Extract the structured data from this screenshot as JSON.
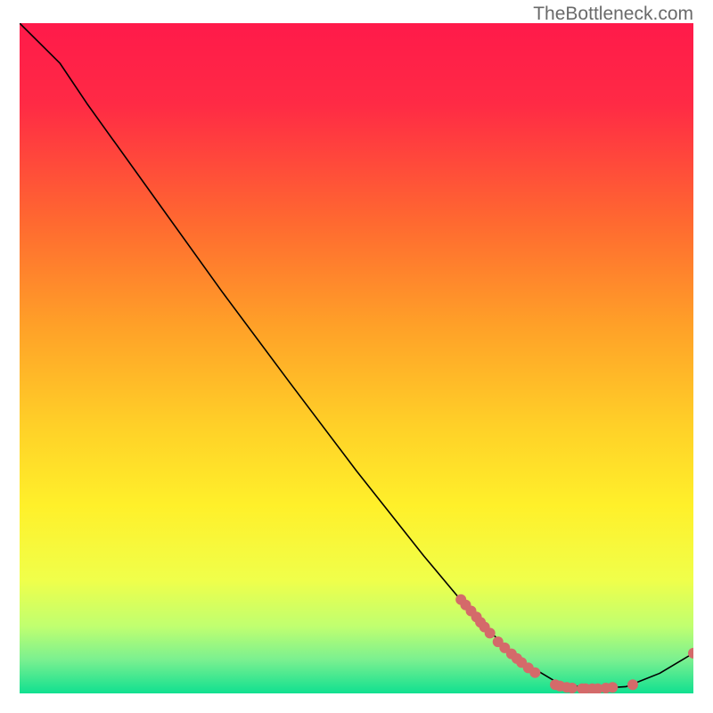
{
  "attribution": "TheBottleneck.com",
  "chart_data": {
    "type": "line",
    "title": "",
    "xlabel": "",
    "ylabel": "",
    "xlim": [
      0,
      100
    ],
    "ylim": [
      0,
      100
    ],
    "gradient_colors": {
      "top": "#ff1a4a",
      "upper_mid": "#ff8a2a",
      "mid": "#ffe22a",
      "lower_mid": "#e8ff5a",
      "bottom": "#11e28a"
    },
    "curve": [
      {
        "x": 0,
        "y": 100
      },
      {
        "x": 6,
        "y": 94
      },
      {
        "x": 10,
        "y": 88
      },
      {
        "x": 20,
        "y": 74
      },
      {
        "x": 30,
        "y": 60
      },
      {
        "x": 40,
        "y": 46.5
      },
      {
        "x": 50,
        "y": 33.2
      },
      {
        "x": 60,
        "y": 20.5
      },
      {
        "x": 65,
        "y": 14.5
      },
      {
        "x": 70,
        "y": 9.0
      },
      {
        "x": 75,
        "y": 4.5
      },
      {
        "x": 80,
        "y": 1.5
      },
      {
        "x": 85,
        "y": 0.7
      },
      {
        "x": 90,
        "y": 1.0
      },
      {
        "x": 95,
        "y": 3.0
      },
      {
        "x": 100,
        "y": 6.0
      }
    ],
    "markers": [
      {
        "x": 65.5,
        "y": 14.0
      },
      {
        "x": 66.2,
        "y": 13.2
      },
      {
        "x": 67.0,
        "y": 12.3
      },
      {
        "x": 67.8,
        "y": 11.4
      },
      {
        "x": 68.4,
        "y": 10.6
      },
      {
        "x": 69.0,
        "y": 9.9
      },
      {
        "x": 69.8,
        "y": 9.0
      },
      {
        "x": 71.0,
        "y": 7.7
      },
      {
        "x": 72.0,
        "y": 6.8
      },
      {
        "x": 73.0,
        "y": 5.9
      },
      {
        "x": 73.8,
        "y": 5.2
      },
      {
        "x": 74.5,
        "y": 4.6
      },
      {
        "x": 75.5,
        "y": 3.8
      },
      {
        "x": 76.5,
        "y": 3.1
      },
      {
        "x": 79.5,
        "y": 1.3
      },
      {
        "x": 80.2,
        "y": 1.1
      },
      {
        "x": 81.2,
        "y": 0.9
      },
      {
        "x": 82.0,
        "y": 0.8
      },
      {
        "x": 83.5,
        "y": 0.7
      },
      {
        "x": 84.0,
        "y": 0.7
      },
      {
        "x": 85.0,
        "y": 0.7
      },
      {
        "x": 85.8,
        "y": 0.7
      },
      {
        "x": 87.0,
        "y": 0.8
      },
      {
        "x": 88.0,
        "y": 0.9
      },
      {
        "x": 91.0,
        "y": 1.3
      },
      {
        "x": 100.0,
        "y": 6.0
      }
    ],
    "marker_style": {
      "color": "#d46a6a",
      "radius_px": 6
    }
  }
}
